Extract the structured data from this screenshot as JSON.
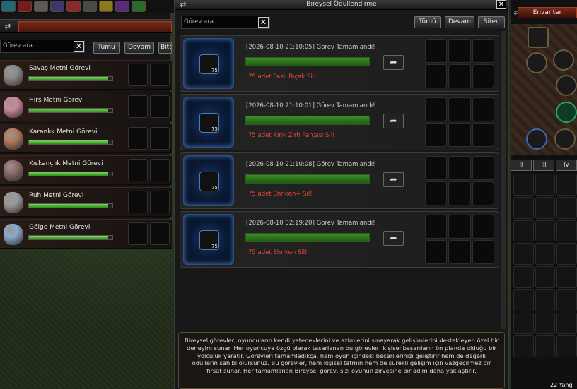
{
  "skillbar": {
    "icons": [
      "shield-icon",
      "close-icon",
      "gear-icon",
      "sword-icon",
      "scroll-icon",
      "dice-icon",
      "sun-icon",
      "orb-icon",
      "leaf-icon"
    ]
  },
  "left_panel": {
    "search_placeholder": "Görev ara...",
    "filters": [
      "Tümü",
      "Devam",
      "Bite"
    ],
    "quests": [
      {
        "name": "Savaş Metni Görevi",
        "progress": 0.95,
        "color": "#8a8a8a"
      },
      {
        "name": "Hırs Metni Görevi",
        "progress": 0.95,
        "color": "#c98a9a"
      },
      {
        "name": "Karanlık Metni Görevi",
        "progress": 0.95,
        "color": "#b07a5a"
      },
      {
        "name": "Kıskançlık Metni Görevi",
        "progress": 0.95,
        "color": "#8a6a6a"
      },
      {
        "name": "Ruh Metni Görevi",
        "progress": 0.95,
        "color": "#9a9a9a"
      },
      {
        "name": "Gölge Metni Görevi",
        "progress": 0.95,
        "color": "#8aaad0"
      }
    ]
  },
  "center": {
    "title": "Bireysel Ödüllendirme",
    "search_placeholder": "Görev ara...",
    "filters": [
      "Tümü",
      "Devam",
      "Biten"
    ],
    "rewards": [
      {
        "timestamp": "[2026-08-10 21:10:05] Görev Tamamlandı!",
        "desc": "75 adet Paslı Bıçak Sil!",
        "count": "75",
        "icon": "knife-icon",
        "progress": 1
      },
      {
        "timestamp": "[2026-08-10 21:10:01] Görev Tamamlandı!",
        "desc": "75 adet Kırık Zırh Parçası Sil!",
        "count": "75",
        "icon": "armor-piece-icon",
        "progress": 1
      },
      {
        "timestamp": "[2026-08-10 21:10:08] Görev Tamamlandı!",
        "desc": "75 adet Shriken+ Sil!",
        "count": "75",
        "icon": "shriken-icon",
        "progress": 1
      },
      {
        "timestamp": "[2026-08-10 02:19:20] Görev Tamamlandı!",
        "desc": "75 adet Shriken Sil!",
        "count": "75",
        "icon": "shriken-icon",
        "progress": 1
      }
    ],
    "info": "Bireysel görevler, oyuncuların kendi yeteneklerini ve azimlerini sınayarak gelişimlerini destekleyen özel bir deneyim sunar. Her oyuncuya özgü olarak tasarlanan bu görevler, kişisel başarıların ön planda olduğu bir yolculuk yaratır. Görevleri tamamladıkça, hem oyun içindeki becerilerinizi geliştirir hem de değerli ödüllerin sahibi olursunuz. Bu görevler, hem kişisel tatmin hem de sürekli gelişim için vazgeçilmez bir fırsat sunar. Her tamamlanan Bireysel görev, sizi oyunun zirvesine bir adım daha yaklaştırır."
  },
  "right_panel": {
    "title": "Envanter",
    "tabs": [
      "II",
      "III",
      "IV"
    ],
    "yang": "22 Yang"
  }
}
